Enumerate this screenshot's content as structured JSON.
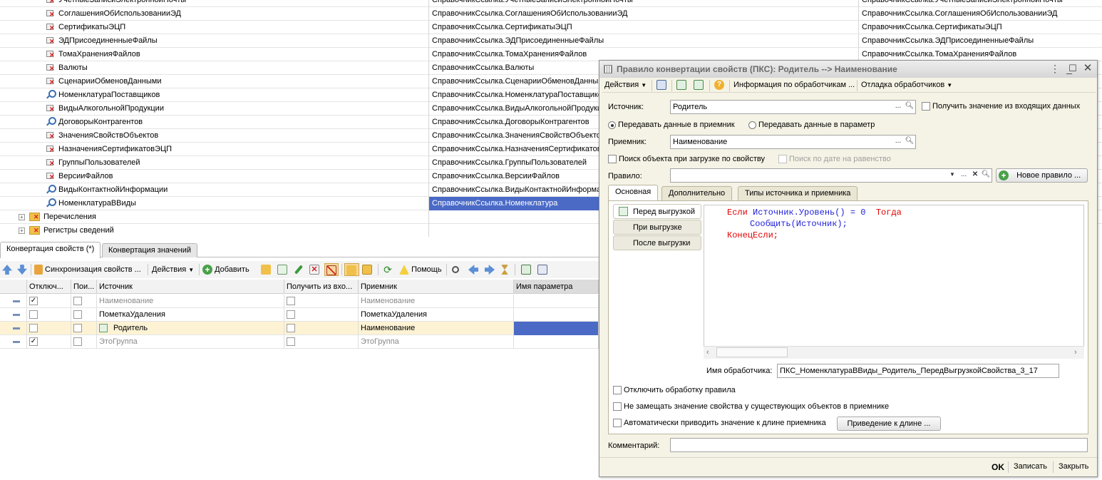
{
  "tree": {
    "rows": [
      {
        "name": "УчетныеЗаписиЭлектроннойПочты",
        "type": "СправочникСсылка.УчетныеЗаписиЭлектроннойПочты",
        "type2": "СправочникСсылка.УчетныеЗаписиЭлектроннойПочты",
        "icon": "x"
      },
      {
        "name": "СоглашенияОбИспользованииЭД",
        "type": "СправочникСсылка.СоглашенияОбИспользованииЭД",
        "type2": "СправочникСсылка.СоглашенияОбИспользованииЭД",
        "icon": "x"
      },
      {
        "name": "СертификатыЭЦП",
        "type": "СправочникСсылка.СертификатыЭЦП",
        "type2": "СправочникСсылка.СертификатыЭЦП",
        "icon": "x"
      },
      {
        "name": "ЭДПрисоединенныеФайлы",
        "type": "СправочникСсылка.ЭДПрисоединенныеФайлы",
        "type2": "СправочникСсылка.ЭДПрисоединенныеФайлы",
        "icon": "x"
      },
      {
        "name": "ТомаХраненияФайлов",
        "type": "СправочникСсылка.ТомаХраненияФайлов",
        "type2": "СправочникСсылка.ТомаХраненияФайлов",
        "icon": "x"
      },
      {
        "name": "Валюты",
        "type": "СправочникСсылка.Валюты",
        "type2": "",
        "icon": "x"
      },
      {
        "name": "СценарииОбменовДанными",
        "type": "СправочникСсылка.СценарииОбменовДанными",
        "type2": "",
        "icon": "x"
      },
      {
        "name": "НоменклатураПоставщиков",
        "type": "СправочникСсылка.НоменклатураПоставщиков",
        "type2": "",
        "icon": "mag"
      },
      {
        "name": "ВидыАлкогольнойПродукции",
        "type": "СправочникСсылка.ВидыАлкогольнойПродукции",
        "type2": "",
        "icon": "x"
      },
      {
        "name": "ДоговорыКонтрагентов",
        "type": "СправочникСсылка.ДоговорыКонтрагентов",
        "type2": "",
        "icon": "mag"
      },
      {
        "name": "ЗначенияСвойствОбъектов",
        "type": "СправочникСсылка.ЗначенияСвойствОбъектов",
        "type2": "",
        "icon": "x"
      },
      {
        "name": "НазначенияСертификатовЭЦП",
        "type": "СправочникСсылка.НазначенияСертификатовЭЦП",
        "type2": "",
        "icon": "x"
      },
      {
        "name": "ГруппыПользователей",
        "type": "СправочникСсылка.ГруппыПользователей",
        "type2": "",
        "icon": "x"
      },
      {
        "name": "ВерсииФайлов",
        "type": "СправочникСсылка.ВерсииФайлов",
        "type2": "",
        "icon": "x"
      },
      {
        "name": "ВидыКонтактнойИнформации",
        "type": "СправочникСсылка.ВидыКонтактнойИнформации",
        "type2": "",
        "icon": "mag"
      },
      {
        "name": "НоменклатураВВиды",
        "type": "СправочникСсылка.Номенклатура",
        "type2": "",
        "icon": "mag",
        "selected": true
      }
    ],
    "groups": [
      {
        "name": "Перечисления"
      },
      {
        "name": "Регистры сведений"
      }
    ]
  },
  "tabs": [
    {
      "label": "Конвертация свойств (*)"
    },
    {
      "label": "Конвертация значений"
    }
  ],
  "toolbar": {
    "sync": "Синхронизация свойств ...",
    "actions": "Действия",
    "add": "Добавить",
    "help": "Помощь"
  },
  "grid": {
    "headers": [
      "Отключ...",
      "Пои...",
      "Источник",
      "Получить из вхо...",
      "Приемник",
      "Имя параметра"
    ],
    "rows": [
      {
        "disabled": true,
        "source": "Наименование",
        "target": "Наименование",
        "grey": true
      },
      {
        "disabled": false,
        "source": "ПометкаУдаления",
        "target": "ПометкаУдаления",
        "grey": false
      },
      {
        "disabled": false,
        "source": "Родитель",
        "target": "Наименование",
        "grey": false,
        "selected": true
      },
      {
        "disabled": true,
        "source": "ЭтоГруппа",
        "target": "ЭтоГруппа",
        "grey": true
      }
    ]
  },
  "dialog": {
    "title": "Правило конвертации свойств (ПКС): Родитель --> Наименование",
    "toolbar": {
      "actions": "Действия",
      "info": "Информация по обработчикам ...",
      "debug": "Отладка обработчиков"
    },
    "source_label": "Источник:",
    "source_value": "Родитель",
    "get_incoming": "Получить значение из входящих данных",
    "radio_target": "Передавать данные в приемник",
    "radio_param": "Передавать данные в параметр",
    "target_label": "Приемник:",
    "target_value": "Наименование",
    "search_by_prop": "Поиск объекта при загрузке по свойству",
    "search_by_date": "Поиск по дате на равенство",
    "rule_label": "Правило:",
    "rule_value": "",
    "new_rule": "Новое правило ...",
    "tabs": [
      "Основная",
      "Дополнительно",
      "Типы источника и приемника"
    ],
    "handlers": [
      "Перед выгрузкой",
      "При выгрузке",
      "После выгрузки"
    ],
    "code": {
      "l1_if": "Если",
      "l1_expr": "Источник.Уровень() = 0",
      "l1_then": "Тогда",
      "l2": "Сообщить(Источник);",
      "l3": "КонецЕсли;"
    },
    "handler_name_label": "Имя обработчика:",
    "handler_name_value": "ПКС_НоменклатураВВиды_Родитель_ПередВыгрузкойСвойства_3_17",
    "disable_rule": "Отключить обработку правила",
    "no_replace": "Не замещать значение свойства у существующих объектов в приемнике",
    "auto_length": "Автоматически приводить значение к длине приемника",
    "cast_length": "Приведение к длине ...",
    "comment_label": "Комментарий:",
    "comment_value": "",
    "ok": "OK",
    "save": "Записать",
    "close": "Закрыть"
  },
  "colors": {
    "selection": "#4a6ac6",
    "row_highlight": "#fdf3d4",
    "dialog_bg": "#f5f3e5",
    "keyword": "#e00000",
    "identifier": "#1d1dd9"
  }
}
